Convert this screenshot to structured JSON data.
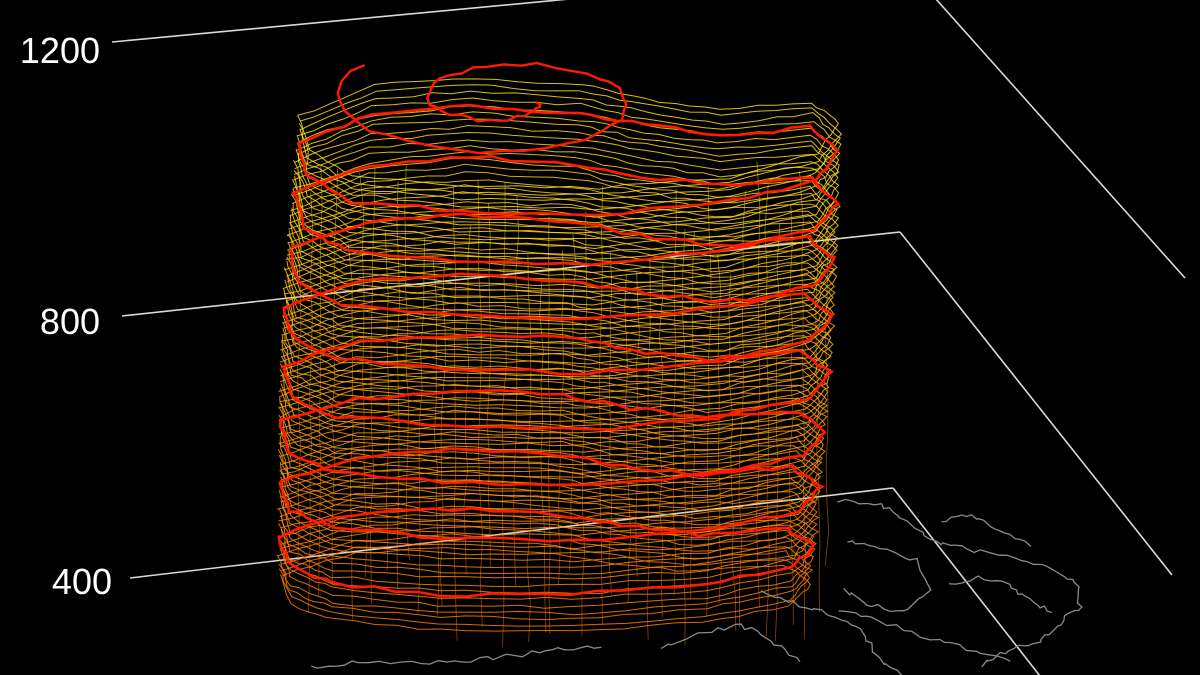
{
  "chart_data": {
    "type": "surface-3d",
    "z_tick_labels": [
      "1200",
      "800",
      "400"
    ],
    "z_ticks": [
      1200,
      800,
      400
    ],
    "z_range": [
      0,
      1200
    ],
    "grid": true,
    "background": "#000000",
    "colors": {
      "axes": "#d9d9d9",
      "coast": "#8a8a8a",
      "contour_highlight": "#ff1a00",
      "gradient_low": "#ff7a00",
      "gradient_high": "#ffe21a"
    },
    "highlight_levels": [
      100,
      250,
      400,
      550,
      700,
      850,
      1000,
      1130
    ]
  }
}
